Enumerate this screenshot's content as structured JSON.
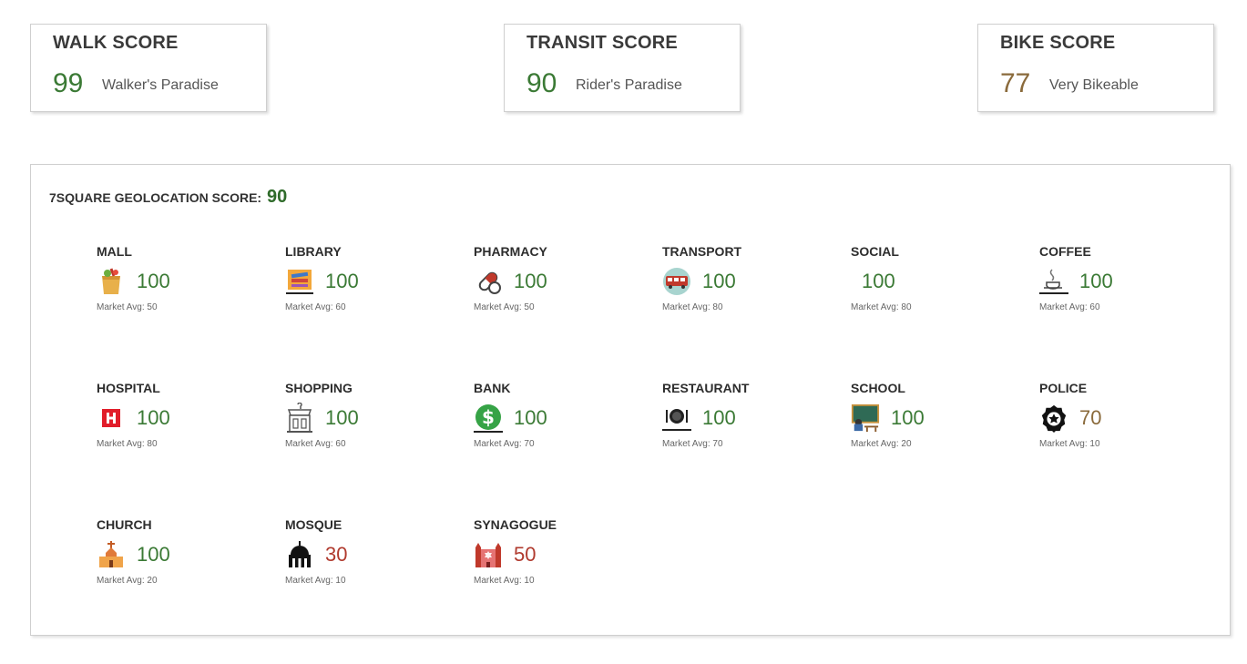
{
  "score_cards": {
    "walk": {
      "title": "WALK SCORE",
      "value": "99",
      "desc": "Walker's Paradise",
      "color": "#3b7a35"
    },
    "transit": {
      "title": "TRANSIT SCORE",
      "value": "90",
      "desc": "Rider's Paradise",
      "color": "#3b7a35"
    },
    "bike": {
      "title": "BIKE SCORE",
      "value": "77",
      "desc": "Very Bikeable",
      "color": "#8a6a3b"
    }
  },
  "geo": {
    "label": "7SQUARE GEOLOCATION SCORE:",
    "value": "90",
    "value_color": "#2f6b2a"
  },
  "categories": [
    {
      "label": "MALL",
      "value": "100",
      "avg": "Market Avg: 50",
      "icon": "grocery-bag-icon",
      "color": "#3b7a35"
    },
    {
      "label": "LIBRARY",
      "value": "100",
      "avg": "Market Avg: 60",
      "icon": "books-icon",
      "color": "#3b7a35"
    },
    {
      "label": "PHARMACY",
      "value": "100",
      "avg": "Market Avg: 50",
      "icon": "pill-icon",
      "color": "#3b7a35"
    },
    {
      "label": "TRANSPORT",
      "value": "100",
      "avg": "Market Avg: 80",
      "icon": "bus-icon",
      "color": "#3b7a35"
    },
    {
      "label": "SOCIAL",
      "value": "100",
      "avg": "Market Avg: 80",
      "icon": "",
      "color": "#3b7a35"
    },
    {
      "label": "COFFEE",
      "value": "100",
      "avg": "Market Avg: 60",
      "icon": "coffee-cup-icon",
      "color": "#3b7a35"
    },
    {
      "label": "HOSPITAL",
      "value": "100",
      "avg": "Market Avg: 80",
      "icon": "hospital-icon",
      "color": "#3b7a35"
    },
    {
      "label": "SHOPPING",
      "value": "100",
      "avg": "Market Avg: 60",
      "icon": "storefront-icon",
      "color": "#3b7a35"
    },
    {
      "label": "BANK",
      "value": "100",
      "avg": "Market Avg: 70",
      "icon": "dollar-icon",
      "color": "#3b7a35"
    },
    {
      "label": "RESTAURANT",
      "value": "100",
      "avg": "Market Avg: 70",
      "icon": "plate-icon",
      "color": "#3b7a35"
    },
    {
      "label": "SCHOOL",
      "value": "100",
      "avg": "Market Avg: 20",
      "icon": "classroom-icon",
      "color": "#3b7a35"
    },
    {
      "label": "POLICE",
      "value": "70",
      "avg": "Market Avg: 10",
      "icon": "police-badge-icon",
      "color": "#8a6a3b"
    },
    {
      "label": "CHURCH",
      "value": "100",
      "avg": "Market Avg: 20",
      "icon": "church-icon",
      "color": "#3b7a35"
    },
    {
      "label": "MOSQUE",
      "value": "30",
      "avg": "Market Avg: 10",
      "icon": "mosque-icon",
      "color": "#b03a2e"
    },
    {
      "label": "SYNAGOGUE",
      "value": "50",
      "avg": "Market Avg: 10",
      "icon": "synagogue-icon",
      "color": "#b03a2e"
    }
  ]
}
